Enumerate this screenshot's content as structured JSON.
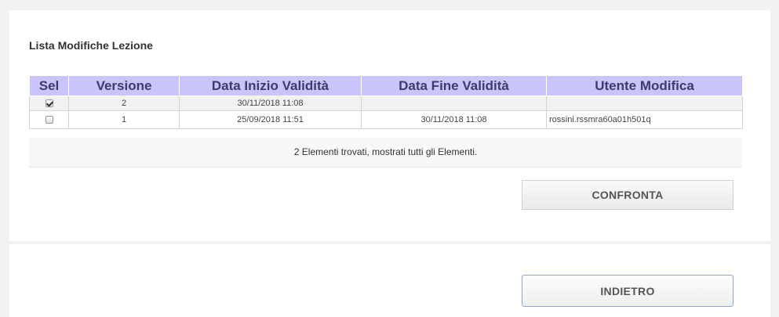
{
  "section": {
    "title": "Lista Modifiche Lezione"
  },
  "table": {
    "headers": [
      "Sel",
      "Versione",
      "Data Inizio Validità",
      "Data Fine Validità",
      "Utente Modifica"
    ],
    "rows": [
      {
        "selected": true,
        "version": "2",
        "start": "30/11/2018 11:08",
        "end": "",
        "user": ""
      },
      {
        "selected": false,
        "version": "1",
        "start": "25/09/2018 11:51",
        "end": "30/11/2018 11:08",
        "user": "rossini.rssmra60a01h501q"
      }
    ],
    "footer": "2 Elementi trovati, mostrati tutti gli Elementi."
  },
  "buttons": {
    "compare": "CONFRONTA",
    "back": "INDIETRO"
  },
  "colors": {
    "header_bg": "#c9c5fb",
    "back_border": "#86a8cf"
  }
}
